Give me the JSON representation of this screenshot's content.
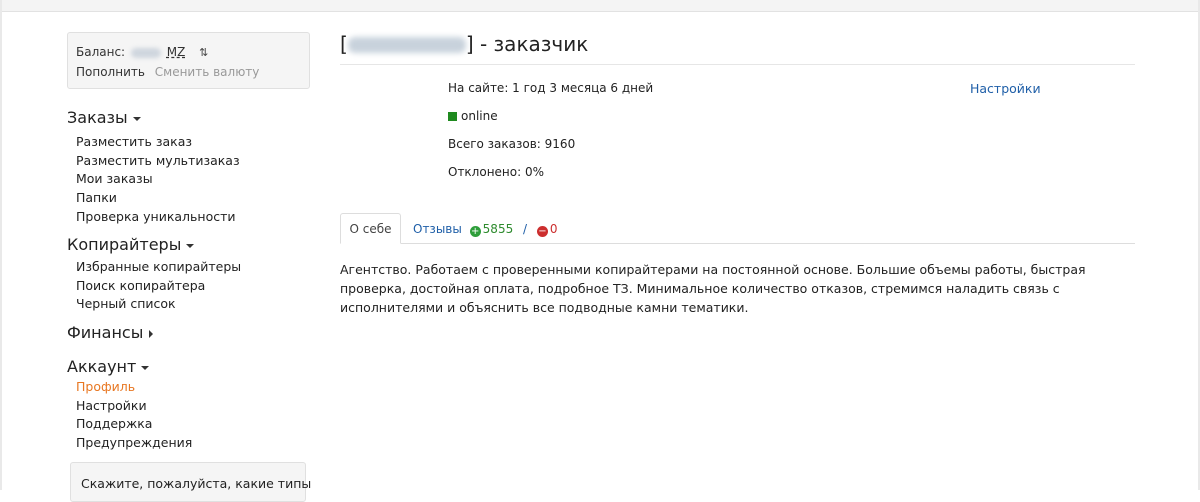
{
  "balance": {
    "label": "Баланс:",
    "currency": "MZ",
    "top_up": "Пополнить",
    "change_currency": "Сменить валюту"
  },
  "sidebar": {
    "orders": {
      "title": "Заказы",
      "items": [
        "Разместить заказ",
        "Разместить мультизаказ",
        "Мои заказы",
        "Папки",
        "Проверка уникальности"
      ]
    },
    "copywriters": {
      "title": "Копирайтеры",
      "items": [
        "Избранные копирайтеры",
        "Поиск копирайтера",
        "Черный список"
      ]
    },
    "finance": {
      "title": "Финансы"
    },
    "account": {
      "title": "Аккаунт",
      "items": [
        "Профиль",
        "Настройки",
        "Поддержка",
        "Предупреждения"
      ],
      "active_index": 0
    },
    "hint": "Скажите, пожалуйста, какие типы"
  },
  "profile": {
    "title_open": "[",
    "title_suffix": "] - заказчик",
    "on_site": "На сайте: 1 год 3 месяца 6 дней",
    "status": "online",
    "total_orders": "Всего заказов: 9160",
    "rejected": "Отклонено: 0%",
    "settings_link": "Настройки"
  },
  "tabs": {
    "about": "О себе",
    "reviews_label": "Отзывы",
    "positive": "5855",
    "separator": "/",
    "negative": "0"
  },
  "about_text": "Агентство. Работаем с проверенными копирайтерами на постоянной основе. Большие объемы работы, быстрая проверка, достойная оплата, подробное ТЗ. Минимальное количество отказов, стремимся наладить связь с исполнителями и объяснить все подводные камни тематики.",
  "colors": {
    "link": "#1f5fa8",
    "active_menu": "#e87722",
    "online": "#1f8a1f",
    "positive": "#2e9e3a",
    "negative": "#cc2e2e"
  }
}
